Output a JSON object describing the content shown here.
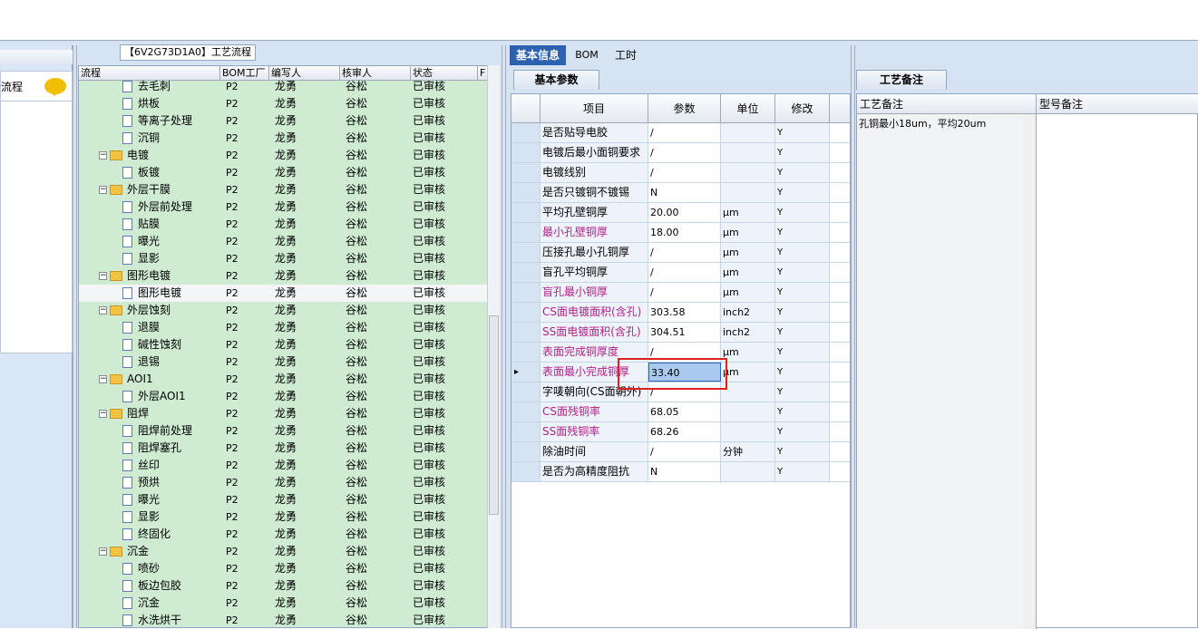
{
  "left_panel": {
    "item_label": "流程"
  },
  "tree": {
    "title": "【6V2G73D1A0】工艺流程",
    "columns": [
      "流程",
      "BOM工厂",
      "编写人",
      "核审人",
      "状态",
      "F"
    ],
    "rows": [
      {
        "level": 2,
        "type": "file",
        "name": "去毛刺",
        "bom": "P2",
        "writer": "龙勇",
        "reviewer": "谷松",
        "status": "已审核"
      },
      {
        "level": 2,
        "type": "file",
        "name": "烘板",
        "bom": "P2",
        "writer": "龙勇",
        "reviewer": "谷松",
        "status": "已审核"
      },
      {
        "level": 2,
        "type": "file",
        "name": "等离子处理",
        "bom": "P2",
        "writer": "龙勇",
        "reviewer": "谷松",
        "status": "已审核"
      },
      {
        "level": 2,
        "type": "file",
        "name": "沉铜",
        "bom": "P2",
        "writer": "龙勇",
        "reviewer": "谷松",
        "status": "已审核"
      },
      {
        "level": 1,
        "type": "folder",
        "name": "电镀",
        "bom": "P2",
        "writer": "龙勇",
        "reviewer": "谷松",
        "status": "已审核"
      },
      {
        "level": 2,
        "type": "file",
        "name": "板镀",
        "bom": "P2",
        "writer": "龙勇",
        "reviewer": "谷松",
        "status": "已审核"
      },
      {
        "level": 1,
        "type": "folder",
        "name": "外层干膜",
        "bom": "P2",
        "writer": "龙勇",
        "reviewer": "谷松",
        "status": "已审核"
      },
      {
        "level": 2,
        "type": "file",
        "name": "外层前处理",
        "bom": "P2",
        "writer": "龙勇",
        "reviewer": "谷松",
        "status": "已审核"
      },
      {
        "level": 2,
        "type": "file",
        "name": "贴膜",
        "bom": "P2",
        "writer": "龙勇",
        "reviewer": "谷松",
        "status": "已审核"
      },
      {
        "level": 2,
        "type": "file",
        "name": "曝光",
        "bom": "P2",
        "writer": "龙勇",
        "reviewer": "谷松",
        "status": "已审核"
      },
      {
        "level": 2,
        "type": "file",
        "name": "显影",
        "bom": "P2",
        "writer": "龙勇",
        "reviewer": "谷松",
        "status": "已审核"
      },
      {
        "level": 1,
        "type": "folder",
        "name": "图形电镀",
        "bom": "P2",
        "writer": "龙勇",
        "reviewer": "谷松",
        "status": "已审核"
      },
      {
        "level": 2,
        "type": "file",
        "name": "图形电镀",
        "bom": "P2",
        "writer": "龙勇",
        "reviewer": "谷松",
        "status": "已审核",
        "selected": true
      },
      {
        "level": 1,
        "type": "folder",
        "name": "外层蚀刻",
        "bom": "P2",
        "writer": "龙勇",
        "reviewer": "谷松",
        "status": "已审核"
      },
      {
        "level": 2,
        "type": "file",
        "name": "退膜",
        "bom": "P2",
        "writer": "龙勇",
        "reviewer": "谷松",
        "status": "已审核"
      },
      {
        "level": 2,
        "type": "file",
        "name": "碱性蚀刻",
        "bom": "P2",
        "writer": "龙勇",
        "reviewer": "谷松",
        "status": "已审核"
      },
      {
        "level": 2,
        "type": "file",
        "name": "退锡",
        "bom": "P2",
        "writer": "龙勇",
        "reviewer": "谷松",
        "status": "已审核"
      },
      {
        "level": 1,
        "type": "folder",
        "name": "AOI1",
        "bom": "P2",
        "writer": "龙勇",
        "reviewer": "谷松",
        "status": "已审核"
      },
      {
        "level": 2,
        "type": "file",
        "name": "外层AOI1",
        "bom": "P2",
        "writer": "龙勇",
        "reviewer": "谷松",
        "status": "已审核"
      },
      {
        "level": 1,
        "type": "folder",
        "name": "阻焊",
        "bom": "P2",
        "writer": "龙勇",
        "reviewer": "谷松",
        "status": "已审核"
      },
      {
        "level": 2,
        "type": "file",
        "name": "阻焊前处理",
        "bom": "P2",
        "writer": "龙勇",
        "reviewer": "谷松",
        "status": "已审核"
      },
      {
        "level": 2,
        "type": "file",
        "name": "阻焊塞孔",
        "bom": "P2",
        "writer": "龙勇",
        "reviewer": "谷松",
        "status": "已审核"
      },
      {
        "level": 2,
        "type": "file",
        "name": "丝印",
        "bom": "P2",
        "writer": "龙勇",
        "reviewer": "谷松",
        "status": "已审核"
      },
      {
        "level": 2,
        "type": "file",
        "name": "预烘",
        "bom": "P2",
        "writer": "龙勇",
        "reviewer": "谷松",
        "status": "已审核"
      },
      {
        "level": 2,
        "type": "file",
        "name": "曝光",
        "bom": "P2",
        "writer": "龙勇",
        "reviewer": "谷松",
        "status": "已审核"
      },
      {
        "level": 2,
        "type": "file",
        "name": "显影",
        "bom": "P2",
        "writer": "龙勇",
        "reviewer": "谷松",
        "status": "已审核"
      },
      {
        "level": 2,
        "type": "file",
        "name": "终固化",
        "bom": "P2",
        "writer": "龙勇",
        "reviewer": "谷松",
        "status": "已审核"
      },
      {
        "level": 1,
        "type": "folder",
        "name": "沉金",
        "bom": "P2",
        "writer": "龙勇",
        "reviewer": "谷松",
        "status": "已审核"
      },
      {
        "level": 2,
        "type": "file",
        "name": "喷砂",
        "bom": "P2",
        "writer": "龙勇",
        "reviewer": "谷松",
        "status": "已审核"
      },
      {
        "level": 2,
        "type": "file",
        "name": "板边包胶",
        "bom": "P2",
        "writer": "龙勇",
        "reviewer": "谷松",
        "status": "已审核"
      },
      {
        "level": 2,
        "type": "file",
        "name": "沉金",
        "bom": "P2",
        "writer": "龙勇",
        "reviewer": "谷松",
        "status": "已审核"
      },
      {
        "level": 2,
        "type": "file",
        "name": "水洗烘干",
        "bom": "P2",
        "writer": "龙勇",
        "reviewer": "谷松",
        "status": "已审核"
      }
    ]
  },
  "tabs": [
    "基本信息",
    "BOM",
    "工时"
  ],
  "params": {
    "subtab": "基本参数",
    "columns": [
      "项目",
      "参数",
      "单位",
      "修改"
    ],
    "rows": [
      {
        "item": "是否贴导电胶",
        "value": "/",
        "unit": "",
        "mod": "Y",
        "pink": false
      },
      {
        "item": "电镀后最小面铜要求",
        "value": "/",
        "unit": "",
        "mod": "Y",
        "pink": false
      },
      {
        "item": "电镀线别",
        "value": "/",
        "unit": "",
        "mod": "Y",
        "pink": false
      },
      {
        "item": "是否只镀铜不镀锡",
        "value": "N",
        "unit": "",
        "mod": "Y",
        "pink": false
      },
      {
        "item": "平均孔壁铜厚",
        "value": "20.00",
        "unit": "μm",
        "mod": "Y",
        "pink": false
      },
      {
        "item": "最小孔壁铜厚",
        "value": "18.00",
        "unit": "μm",
        "mod": "Y",
        "pink": true
      },
      {
        "item": "压接孔最小孔铜厚",
        "value": "/",
        "unit": "μm",
        "mod": "Y",
        "pink": false
      },
      {
        "item": "盲孔平均铜厚",
        "value": "/",
        "unit": "μm",
        "mod": "Y",
        "pink": false
      },
      {
        "item": "盲孔最小铜厚",
        "value": "/",
        "unit": "μm",
        "mod": "Y",
        "pink": true
      },
      {
        "item": "CS面电镀面积(含孔)",
        "value": "303.58",
        "unit": "inch2",
        "mod": "Y",
        "pink": true
      },
      {
        "item": "SS面电镀面积(含孔)",
        "value": "304.51",
        "unit": "inch2",
        "mod": "Y",
        "pink": true
      },
      {
        "item": "表面完成铜厚度",
        "value": "/",
        "unit": "μm",
        "mod": "Y",
        "pink": true
      },
      {
        "item": "表面最小完成铜厚",
        "value": "33.40",
        "unit": "μm",
        "mod": "Y",
        "pink": true,
        "current": true
      },
      {
        "item": "字唛朝向(CS面朝外)",
        "value": "/",
        "unit": "",
        "mod": "Y",
        "pink": false
      },
      {
        "item": "CS面残铜率",
        "value": "68.05",
        "unit": "",
        "mod": "Y",
        "pink": true
      },
      {
        "item": "SS面残铜率",
        "value": "68.26",
        "unit": "",
        "mod": "Y",
        "pink": true
      },
      {
        "item": "除油时间",
        "value": "/",
        "unit": "分钟",
        "mod": "Y",
        "pink": false
      },
      {
        "item": "是否为高精度阻抗",
        "value": "N",
        "unit": "",
        "mod": "Y",
        "pink": false
      }
    ]
  },
  "notes": {
    "tab": "工艺备注",
    "col1": "工艺备注",
    "col2": "型号备注",
    "text": "孔铜最小18um，平均20um"
  },
  "colors": {
    "accent": "#2c62b0",
    "tree_bg": "#cfecd3",
    "pink": "#b0208a",
    "highlight": "#e02020"
  }
}
